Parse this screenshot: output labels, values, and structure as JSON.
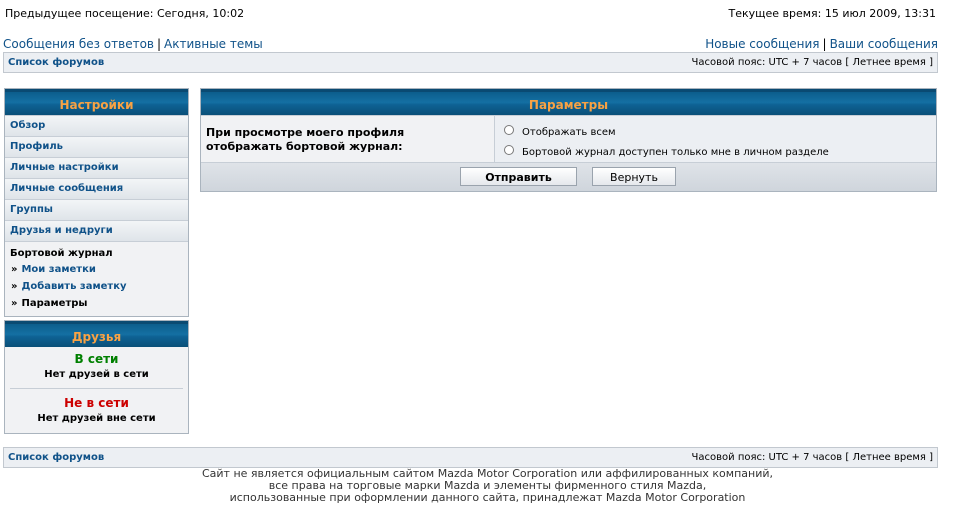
{
  "header": {
    "last_visit": "Предыдущее посещение: Сегодня, 10:02",
    "current_time": "Текущее время: 15 июл 2009, 13:31"
  },
  "nav": {
    "unanswered": "Сообщения без ответов",
    "active": "Активные темы",
    "new_posts": "Новые сообщения",
    "your_posts": "Ваши сообщения",
    "separator": "|"
  },
  "breadcrumb_bar": {
    "forum_list": "Список форумов",
    "timezone": "Часовой пояс: UTC + 7 часов [ Летнее время ]"
  },
  "settings_menu": {
    "title": "Настройки",
    "items": [
      {
        "label": "Обзор"
      },
      {
        "label": "Профиль"
      },
      {
        "label": "Личные настройки"
      },
      {
        "label": "Личные сообщения"
      },
      {
        "label": "Группы"
      },
      {
        "label": "Друзья и недруги"
      }
    ],
    "active_section": {
      "title": "Бортовой журнал",
      "arrow": "»",
      "sub_items": [
        {
          "label": "Мои заметки",
          "link": true
        },
        {
          "label": "Добавить заметку",
          "link": true
        },
        {
          "label": "Параметры",
          "link": false
        }
      ]
    }
  },
  "friends": {
    "title": "Друзья",
    "online_label": "В сети",
    "online_text": "Нет друзей в сети",
    "offline_label": "Не в сети",
    "offline_text": "Нет друзей вне сети",
    "online_color": "#008000",
    "offline_color": "#cc0000"
  },
  "params_panel": {
    "title": "Параметры",
    "question_line1": "При просмотре моего профиля",
    "question_line2": "отображать бортовой журнал:",
    "options": [
      {
        "label": "Отображать всем",
        "selected": false
      },
      {
        "label": "Бортовой журнал доступен только мне в личном разделе",
        "selected": false
      }
    ],
    "submit": "Отправить",
    "reset": "Вернуть"
  },
  "footer": {
    "line1": "Сайт не является официальным сайтом Mazda Motor Corporation или аффилированных компаний,",
    "line2": "все права на торговые марки Mazda и элементы фирменного стиля Mazda,",
    "line3": "использованные при оформлении данного сайта, принадлежат Mazda Motor Corporation"
  }
}
